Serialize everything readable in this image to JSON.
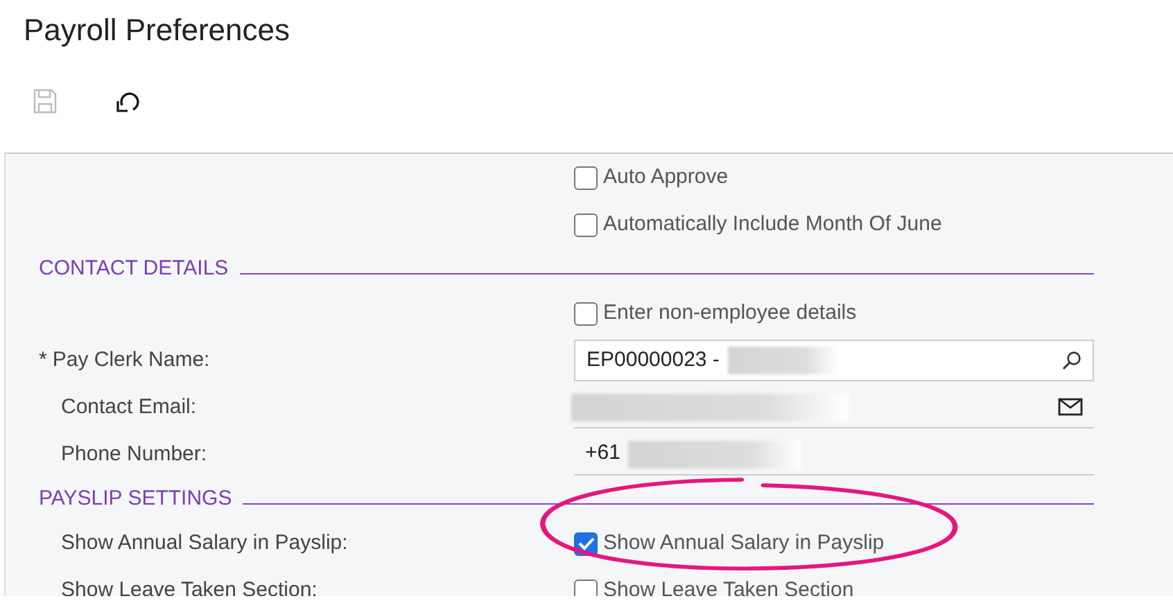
{
  "page_title": "Payroll Preferences",
  "toolbar": [
    {
      "kind": "save",
      "disabled": true
    },
    {
      "kind": "undo",
      "disabled": false
    }
  ],
  "sections": [
    {
      "rows": [
        {
          "kind": "checkbox",
          "text": "Auto Approve",
          "checked": false
        },
        {
          "kind": "checkbox",
          "text": "Automatically Include Month Of June",
          "checked": false
        }
      ]
    },
    {
      "header": "CONTACT DETAILS",
      "rows": [
        {
          "kind": "checkbox",
          "text": "Enter non-employee details",
          "checked": false
        },
        {
          "kind": "lookup",
          "required_mark": "*",
          "label": "Pay Clerk Name:",
          "value": "EP00000023 -",
          "redacted": true
        },
        {
          "kind": "email",
          "label": "Contact Email:",
          "redacted": true
        },
        {
          "kind": "phone",
          "label": "Phone Number:",
          "value": "+61",
          "redacted": true
        }
      ]
    },
    {
      "header": "PAYSLIP SETTINGS",
      "rows": [
        {
          "kind": "checkbox",
          "label": "Show Annual Salary in Payslip:",
          "text": "Show Annual Salary in Payslip",
          "checked": true,
          "highlighted": true
        },
        {
          "kind": "checkbox",
          "label": "Show Leave Taken Section:",
          "text": "Show Leave Taken Section",
          "checked": false
        }
      ]
    }
  ]
}
